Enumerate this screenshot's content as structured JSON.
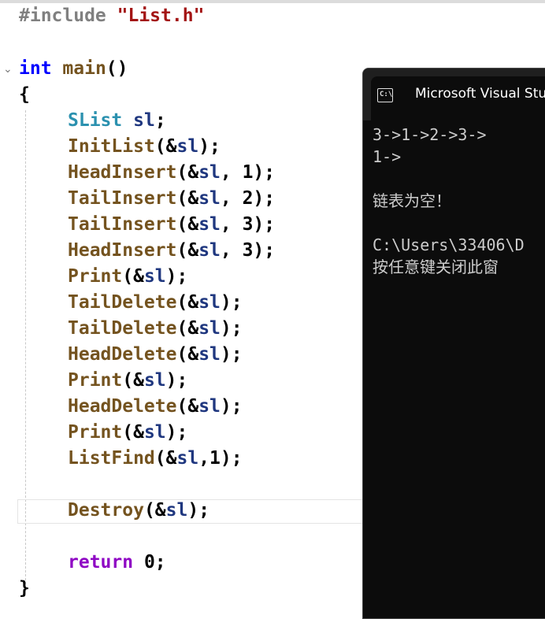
{
  "editor": {
    "include": {
      "directive": "#include",
      "file": "\"List.h\""
    },
    "main_sig": {
      "type": "int",
      "name": "main",
      "parens": "()"
    },
    "open_brace": "{",
    "close_brace": "}",
    "decl": {
      "type": "SList",
      "var": "sl",
      "semi": ";"
    },
    "calls": [
      {
        "fn": "InitList",
        "pre": "(&",
        "var": "sl",
        "post": ");"
      },
      {
        "fn": "HeadInsert",
        "pre": "(&",
        "var": "sl",
        "post": ", 1);"
      },
      {
        "fn": "TailInsert",
        "pre": "(&",
        "var": "sl",
        "post": ", 2);"
      },
      {
        "fn": "TailInsert",
        "pre": "(&",
        "var": "sl",
        "post": ", 3);"
      },
      {
        "fn": "HeadInsert",
        "pre": "(&",
        "var": "sl",
        "post": ", 3);"
      },
      {
        "fn": "Print",
        "pre": "(&",
        "var": "sl",
        "post": ");"
      },
      {
        "fn": "TailDelete",
        "pre": "(&",
        "var": "sl",
        "post": ");"
      },
      {
        "fn": "TailDelete",
        "pre": "(&",
        "var": "sl",
        "post": ");"
      },
      {
        "fn": "HeadDelete",
        "pre": "(&",
        "var": "sl",
        "post": ");"
      },
      {
        "fn": "Print",
        "pre": "(&",
        "var": "sl",
        "post": ");"
      },
      {
        "fn": "HeadDelete",
        "pre": "(&",
        "var": "sl",
        "post": ");"
      },
      {
        "fn": "Print",
        "pre": "(&",
        "var": "sl",
        "post": ");"
      },
      {
        "fn": "ListFind",
        "pre": "(&",
        "var": "sl",
        "post": ",1);"
      }
    ],
    "destroy": {
      "fn": "Destroy",
      "pre": "(&",
      "var": "sl",
      "post": ");"
    },
    "ret": {
      "kw": "return",
      "val": "0;"
    }
  },
  "console": {
    "title": "Microsoft Visual Stu",
    "icon": "cmd-icon",
    "lines": [
      "3->1->2->3->",
      "1->",
      "",
      "链表为空！",
      "",
      "C:\\Users\\33406\\D",
      "按任意键关闭此窗"
    ]
  }
}
